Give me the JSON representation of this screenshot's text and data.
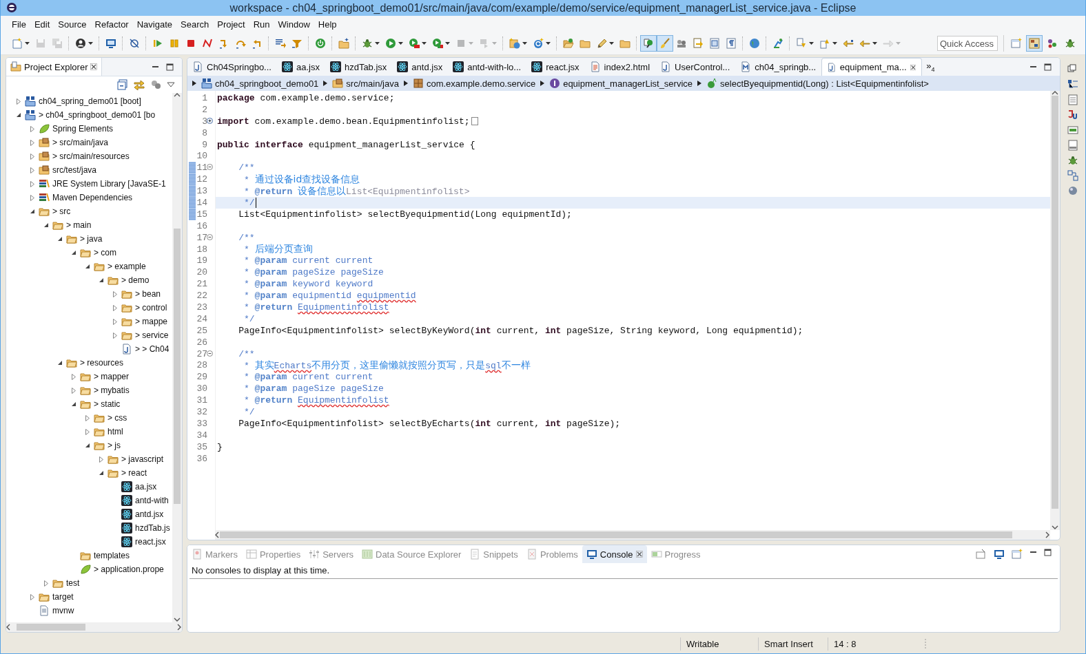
{
  "window": {
    "title": "workspace - ch04_springboot_demo01/src/main/java/com/example/demo/service/equipment_managerList_service.java - Eclipse"
  },
  "menu": [
    {
      "label": "File"
    },
    {
      "label": "Edit"
    },
    {
      "label": "Source"
    },
    {
      "label": "Refactor"
    },
    {
      "label": "Navigate"
    },
    {
      "label": "Search"
    },
    {
      "label": "Project"
    },
    {
      "label": "Run"
    },
    {
      "label": "Window"
    },
    {
      "label": "Help"
    }
  ],
  "toolbar": [
    {
      "kind": "new",
      "dropdown": true,
      "disabled": false,
      "pressed": false
    },
    {
      "kind": "save",
      "dropdown": false,
      "disabled": true,
      "pressed": false
    },
    {
      "kind": "save-all",
      "dropdown": false,
      "disabled": true,
      "pressed": false
    },
    {
      "kind": "separator"
    },
    {
      "kind": "account",
      "dropdown": true,
      "disabled": false,
      "pressed": false
    },
    {
      "kind": "separator"
    },
    {
      "kind": "monitor",
      "dropdown": false,
      "disabled": false,
      "pressed": false
    },
    {
      "kind": "separator"
    },
    {
      "kind": "skip",
      "dropdown": false,
      "disabled": false,
      "pressed": false
    },
    {
      "kind": "separator"
    },
    {
      "kind": "resume",
      "dropdown": false,
      "disabled": false,
      "pressed": false
    },
    {
      "kind": "suspend",
      "dropdown": false,
      "disabled": false,
      "pressed": false
    },
    {
      "kind": "terminate",
      "dropdown": false,
      "disabled": false,
      "pressed": false
    },
    {
      "kind": "disconnect",
      "dropdown": false,
      "disabled": false,
      "pressed": false
    },
    {
      "kind": "step-into",
      "dropdown": false,
      "disabled": false,
      "pressed": false
    },
    {
      "kind": "step-over",
      "dropdown": false,
      "disabled": false,
      "pressed": false
    },
    {
      "kind": "step-return",
      "dropdown": false,
      "disabled": false,
      "pressed": false
    },
    {
      "kind": "separator"
    },
    {
      "kind": "list-arrow",
      "dropdown": false,
      "disabled": false,
      "pressed": false
    },
    {
      "kind": "step-filter",
      "dropdown": false,
      "disabled": false,
      "pressed": false
    },
    {
      "kind": "separator"
    },
    {
      "kind": "power",
      "dropdown": false,
      "disabled": false,
      "pressed": false
    },
    {
      "kind": "separator"
    },
    {
      "kind": "new-folder",
      "dropdown": false,
      "disabled": false,
      "pressed": false
    },
    {
      "kind": "separator"
    },
    {
      "kind": "debug",
      "dropdown": true,
      "disabled": false,
      "pressed": false
    },
    {
      "kind": "run",
      "dropdown": true,
      "disabled": false,
      "pressed": false
    },
    {
      "kind": "run-server",
      "dropdown": true,
      "disabled": false,
      "pressed": false
    },
    {
      "kind": "coverage",
      "dropdown": true,
      "disabled": false,
      "pressed": false
    },
    {
      "kind": "stop",
      "dropdown": true,
      "disabled": true,
      "pressed": false
    },
    {
      "kind": "external",
      "dropdown": true,
      "disabled": true,
      "pressed": false
    },
    {
      "kind": "separator"
    },
    {
      "kind": "globe-new",
      "dropdown": true,
      "disabled": false,
      "pressed": false
    },
    {
      "kind": "new-class",
      "dropdown": true,
      "disabled": false,
      "pressed": false
    },
    {
      "kind": "separator"
    },
    {
      "kind": "open-folder",
      "dropdown": false,
      "disabled": false,
      "pressed": false
    },
    {
      "kind": "folder",
      "dropdown": false,
      "disabled": false,
      "pressed": false
    },
    {
      "kind": "pen",
      "dropdown": true,
      "disabled": false,
      "pressed": false
    },
    {
      "kind": "folder",
      "dropdown": false,
      "disabled": false,
      "pressed": false
    },
    {
      "kind": "separator"
    },
    {
      "kind": "occurrences",
      "dropdown": false,
      "disabled": false,
      "pressed": true
    },
    {
      "kind": "brush",
      "dropdown": false,
      "disabled": false,
      "pressed": true
    },
    {
      "kind": "people",
      "dropdown": false,
      "disabled": false,
      "pressed": false
    },
    {
      "kind": "doc-arrow",
      "dropdown": false,
      "disabled": false,
      "pressed": false
    },
    {
      "kind": "block",
      "dropdown": false,
      "disabled": false,
      "pressed": false
    },
    {
      "kind": "whitespace",
      "dropdown": false,
      "disabled": false,
      "pressed": false
    },
    {
      "kind": "separator"
    },
    {
      "kind": "globe",
      "dropdown": false,
      "disabled": false,
      "pressed": false
    },
    {
      "kind": "separator"
    },
    {
      "kind": "person-run",
      "dropdown": false,
      "disabled": false,
      "pressed": false
    },
    {
      "kind": "separator"
    },
    {
      "kind": "next-annotation",
      "dropdown": true,
      "disabled": false,
      "pressed": false
    },
    {
      "kind": "prev-annotation",
      "dropdown": true,
      "disabled": false,
      "pressed": false
    },
    {
      "kind": "last-edit",
      "dropdown": false,
      "disabled": false,
      "pressed": false
    },
    {
      "kind": "back",
      "dropdown": true,
      "disabled": false,
      "pressed": false
    },
    {
      "kind": "forward",
      "dropdown": true,
      "disabled": true,
      "pressed": false
    }
  ],
  "quick_access": {
    "placeholder": "Quick Access"
  },
  "perspectives": [
    {
      "kind": "open-perspective",
      "selected": false
    },
    {
      "kind": "java-ee",
      "selected": true
    },
    {
      "kind": "spring",
      "selected": false
    },
    {
      "kind": "debug",
      "selected": false
    }
  ],
  "project_explorer": {
    "title": "Project Explorer",
    "tree": [
      {
        "label": "ch04_spring_demo01 [boot]",
        "kind": "project",
        "expanded": false
      },
      {
        "label": "> ch04_springboot_demo01 [bo",
        "kind": "project",
        "expanded": true,
        "children": [
          {
            "label": "Spring Elements",
            "kind": "spring",
            "expanded": false
          },
          {
            "label": "> src/main/java",
            "kind": "source-folder",
            "expanded": false
          },
          {
            "label": "> src/main/resources",
            "kind": "source-folder",
            "expanded": false
          },
          {
            "label": "src/test/java",
            "kind": "source-folder",
            "expanded": false
          },
          {
            "label": "JRE System Library [JavaSE-1",
            "kind": "library",
            "expanded": false
          },
          {
            "label": "Maven Dependencies",
            "kind": "library",
            "expanded": false
          },
          {
            "label": "> src",
            "kind": "folder",
            "expanded": true,
            "children": [
              {
                "label": "> main",
                "kind": "folder",
                "expanded": true,
                "children": [
                  {
                    "label": "> java",
                    "kind": "folder",
                    "expanded": true,
                    "children": [
                      {
                        "label": "> com",
                        "kind": "folder",
                        "expanded": true,
                        "children": [
                          {
                            "label": "> example",
                            "kind": "folder",
                            "expanded": true,
                            "children": [
                              {
                                "label": "> demo",
                                "kind": "folder",
                                "expanded": true,
                                "children": [
                                  {
                                    "label": "> bean",
                                    "kind": "folder",
                                    "expanded": false
                                  },
                                  {
                                    "label": "> control",
                                    "kind": "folder",
                                    "expanded": false
                                  },
                                  {
                                    "label": "> mappe",
                                    "kind": "folder",
                                    "expanded": false
                                  },
                                  {
                                    "label": "> service",
                                    "kind": "folder",
                                    "expanded": false
                                  },
                                  {
                                    "label": "> > Ch04",
                                    "kind": "java-file"
                                  }
                                ]
                              }
                            ]
                          }
                        ]
                      }
                    ]
                  },
                  {
                    "label": "> resources",
                    "kind": "folder",
                    "expanded": true,
                    "children": [
                      {
                        "label": "> mapper",
                        "kind": "folder",
                        "expanded": false
                      },
                      {
                        "label": "> mybatis",
                        "kind": "folder",
                        "expanded": false
                      },
                      {
                        "label": "> static",
                        "kind": "folder",
                        "expanded": true,
                        "children": [
                          {
                            "label": "> css",
                            "kind": "folder",
                            "expanded": false
                          },
                          {
                            "label": "html",
                            "kind": "folder",
                            "expanded": false
                          },
                          {
                            "label": "> js",
                            "kind": "folder",
                            "expanded": true,
                            "children": [
                              {
                                "label": "> javascript",
                                "kind": "folder",
                                "expanded": false
                              },
                              {
                                "label": "> react",
                                "kind": "folder",
                                "expanded": true,
                                "children": [
                                  {
                                    "label": "aa.jsx",
                                    "kind": "react-file"
                                  },
                                  {
                                    "label": "antd-with",
                                    "kind": "react-file"
                                  },
                                  {
                                    "label": "antd.jsx",
                                    "kind": "react-file"
                                  },
                                  {
                                    "label": "hzdTab.js",
                                    "kind": "react-file"
                                  },
                                  {
                                    "label": "react.jsx",
                                    "kind": "react-file"
                                  }
                                ]
                              }
                            ]
                          }
                        ]
                      },
                      {
                        "label": "templates",
                        "kind": "folder"
                      },
                      {
                        "label": "> application.prope",
                        "kind": "spring"
                      }
                    ]
                  }
                ]
              },
              {
                "label": "test",
                "kind": "folder",
                "expanded": false
              }
            ]
          },
          {
            "label": "target",
            "kind": "folder",
            "expanded": false
          },
          {
            "label": "mvnw",
            "kind": "text-file"
          }
        ]
      }
    ]
  },
  "editor_tabs": [
    {
      "label": "Ch04Springbo...",
      "kind": "java",
      "selected": false
    },
    {
      "label": "aa.jsx",
      "kind": "react",
      "selected": false
    },
    {
      "label": "hzdTab.jsx",
      "kind": "react",
      "selected": false
    },
    {
      "label": "antd.jsx",
      "kind": "react",
      "selected": false
    },
    {
      "label": "antd-with-lo...",
      "kind": "react",
      "selected": false
    },
    {
      "label": "react.jsx",
      "kind": "react",
      "selected": false
    },
    {
      "label": "index2.html",
      "kind": "html",
      "selected": false
    },
    {
      "label": "UserControl...",
      "kind": "java",
      "selected": false
    },
    {
      "label": "ch04_springb...",
      "kind": "maven",
      "selected": false
    },
    {
      "label": "equipment_ma...",
      "kind": "java",
      "selected": true
    }
  ],
  "tab_overflow": {
    "symbol": "»",
    "count": "4"
  },
  "breadcrumb": [
    {
      "label": "ch04_springboot_demo01",
      "kind": "project"
    },
    {
      "label": "src/main/java",
      "kind": "source-folder"
    },
    {
      "label": "com.example.demo.service",
      "kind": "package"
    },
    {
      "label": "equipment_managerList_service",
      "kind": "interface"
    },
    {
      "label": "selectByequipmentid(Long) : List<Equipmentinfolist>",
      "kind": "method"
    }
  ],
  "code": [
    {
      "number": "1",
      "changed": false,
      "current": false,
      "segments": [
        {
          "kind": "keyword",
          "text": "package"
        },
        {
          "kind": "plain",
          "text": " com.example.demo.service;"
        }
      ]
    },
    {
      "number": "2",
      "changed": false,
      "current": false
    },
    {
      "number": "3",
      "changed": false,
      "current": false,
      "folded": true,
      "segments": [
        {
          "kind": "keyword",
          "text": "import"
        },
        {
          "kind": "plain",
          "text": " com.example.demo.bean.Equipmentinfolist;"
        }
      ]
    },
    {
      "number": "8",
      "changed": false,
      "current": false
    },
    {
      "number": "9",
      "changed": false,
      "current": false,
      "segments": [
        {
          "kind": "keyword",
          "text": "public interface"
        },
        {
          "kind": "plain",
          "text": " equipment_managerList_service {"
        }
      ]
    },
    {
      "number": "10",
      "changed": false,
      "current": false
    },
    {
      "number": "11",
      "changed": true,
      "current": false,
      "folded": false,
      "segments": [
        {
          "kind": "doc",
          "text": "    /**"
        }
      ]
    },
    {
      "number": "12",
      "changed": true,
      "current": false,
      "segments": [
        {
          "kind": "doc",
          "text": "     * "
        },
        {
          "kind": "doc-text",
          "text": "通过设备id查找设备信息"
        }
      ]
    },
    {
      "number": "13",
      "changed": true,
      "current": false,
      "segments": [
        {
          "kind": "doc",
          "text": "     * "
        },
        {
          "kind": "doc-tag",
          "text": "@return "
        },
        {
          "kind": "doc-text",
          "text": "设备信息以"
        },
        {
          "kind": "doc-code",
          "text": "List<Equipmentinfolist>"
        }
      ]
    },
    {
      "number": "14",
      "changed": true,
      "current": true,
      "segments": [
        {
          "kind": "doc",
          "text": "     */"
        }
      ]
    },
    {
      "number": "15",
      "changed": true,
      "current": false,
      "segments": [
        {
          "kind": "plain",
          "text": "    List<Equipmentinfolist> selectByequipmentid(Long equipmentId);"
        }
      ]
    },
    {
      "number": "16",
      "changed": false,
      "current": false
    },
    {
      "number": "17",
      "changed": false,
      "current": false,
      "folded": false,
      "segments": [
        {
          "kind": "doc",
          "text": "    /**"
        }
      ]
    },
    {
      "number": "18",
      "changed": false,
      "current": false,
      "segments": [
        {
          "kind": "doc",
          "text": "     * "
        },
        {
          "kind": "doc-text",
          "text": "后端分页查询"
        }
      ]
    },
    {
      "number": "19",
      "changed": false,
      "current": false,
      "segments": [
        {
          "kind": "doc",
          "text": "     * "
        },
        {
          "kind": "doc-tag",
          "text": "@param"
        },
        {
          "kind": "doc",
          "text": " current current"
        }
      ]
    },
    {
      "number": "20",
      "changed": false,
      "current": false,
      "segments": [
        {
          "kind": "doc",
          "text": "     * "
        },
        {
          "kind": "doc-tag",
          "text": "@param"
        },
        {
          "kind": "doc",
          "text": " pageSize pageSize"
        }
      ]
    },
    {
      "number": "21",
      "changed": false,
      "current": false,
      "segments": [
        {
          "kind": "doc",
          "text": "     * "
        },
        {
          "kind": "doc-tag",
          "text": "@param"
        },
        {
          "kind": "doc",
          "text": " keyword keyword"
        }
      ]
    },
    {
      "number": "22",
      "changed": false,
      "current": false,
      "segments": [
        {
          "kind": "doc",
          "text": "     * "
        },
        {
          "kind": "doc-tag",
          "text": "@param"
        },
        {
          "kind": "doc",
          "text": " equipmentid "
        },
        {
          "kind": "misspelled",
          "text": "equipmentid"
        }
      ]
    },
    {
      "number": "23",
      "changed": false,
      "current": false,
      "segments": [
        {
          "kind": "doc",
          "text": "     * "
        },
        {
          "kind": "doc-tag",
          "text": "@return "
        },
        {
          "kind": "misspelled",
          "text": "Equipmentinfolist"
        }
      ]
    },
    {
      "number": "24",
      "changed": false,
      "current": false,
      "segments": [
        {
          "kind": "doc",
          "text": "     */"
        }
      ]
    },
    {
      "number": "25",
      "changed": false,
      "current": false,
      "segments": [
        {
          "kind": "plain",
          "text": "    PageInfo<Equipmentinfolist> selectByKeyWord("
        },
        {
          "kind": "keyword",
          "text": "int"
        },
        {
          "kind": "plain",
          "text": " current, "
        },
        {
          "kind": "keyword",
          "text": "int"
        },
        {
          "kind": "plain",
          "text": " pageSize, String keyword, Long equipmentid);"
        }
      ]
    },
    {
      "number": "26",
      "changed": false,
      "current": false
    },
    {
      "number": "27",
      "changed": false,
      "current": false,
      "folded": false,
      "segments": [
        {
          "kind": "doc",
          "text": "    /**"
        }
      ]
    },
    {
      "number": "28",
      "changed": false,
      "current": false,
      "segments": [
        {
          "kind": "doc",
          "text": "     * "
        },
        {
          "kind": "doc-text",
          "text": "其实"
        },
        {
          "kind": "misspelled",
          "text": "Echarts"
        },
        {
          "kind": "doc-text",
          "text": "不用分页，这里偷懒就按照分页写，只是"
        },
        {
          "kind": "misspelled",
          "text": "sql"
        },
        {
          "kind": "doc-text",
          "text": "不一样"
        }
      ]
    },
    {
      "number": "29",
      "changed": false,
      "current": false,
      "segments": [
        {
          "kind": "doc",
          "text": "     * "
        },
        {
          "kind": "doc-tag",
          "text": "@param"
        },
        {
          "kind": "doc",
          "text": " current current"
        }
      ]
    },
    {
      "number": "30",
      "changed": false,
      "current": false,
      "segments": [
        {
          "kind": "doc",
          "text": "     * "
        },
        {
          "kind": "doc-tag",
          "text": "@param"
        },
        {
          "kind": "doc",
          "text": " pageSize pageSize"
        }
      ]
    },
    {
      "number": "31",
      "changed": false,
      "current": false,
      "segments": [
        {
          "kind": "doc",
          "text": "     * "
        },
        {
          "kind": "doc-tag",
          "text": "@return "
        },
        {
          "kind": "misspelled",
          "text": "Equipmentinfolist"
        }
      ]
    },
    {
      "number": "32",
      "changed": false,
      "current": false,
      "segments": [
        {
          "kind": "doc",
          "text": "     */"
        }
      ]
    },
    {
      "number": "33",
      "changed": false,
      "current": false,
      "segments": [
        {
          "kind": "plain",
          "text": "    PageInfo<Equipmentinfolist> selectByEcharts("
        },
        {
          "kind": "keyword",
          "text": "int"
        },
        {
          "kind": "plain",
          "text": " current, "
        },
        {
          "kind": "keyword",
          "text": "int"
        },
        {
          "kind": "plain",
          "text": " pageSize);"
        }
      ]
    },
    {
      "number": "34",
      "changed": false,
      "current": false
    },
    {
      "number": "35",
      "changed": false,
      "current": false,
      "segments": [
        {
          "kind": "plain",
          "text": "}"
        }
      ]
    },
    {
      "number": "36",
      "changed": false,
      "current": false
    }
  ],
  "bottom_tabs": [
    {
      "label": "Markers",
      "kind": "markers",
      "selected": false
    },
    {
      "label": "Properties",
      "kind": "properties",
      "selected": false
    },
    {
      "label": "Servers",
      "kind": "servers",
      "selected": false
    },
    {
      "label": "Data Source Explorer",
      "kind": "datasource",
      "selected": false
    },
    {
      "label": "Snippets",
      "kind": "snippets",
      "selected": false
    },
    {
      "label": "Problems",
      "kind": "problems",
      "selected": false
    },
    {
      "label": "Console",
      "kind": "console",
      "selected": true
    },
    {
      "label": "Progress",
      "kind": "progress",
      "selected": false
    }
  ],
  "console": {
    "message": "No consoles to display at this time."
  },
  "status_bar": [
    {
      "text": "Writable"
    },
    {
      "text": "Smart Insert"
    },
    {
      "text": "14 : 8"
    }
  ]
}
